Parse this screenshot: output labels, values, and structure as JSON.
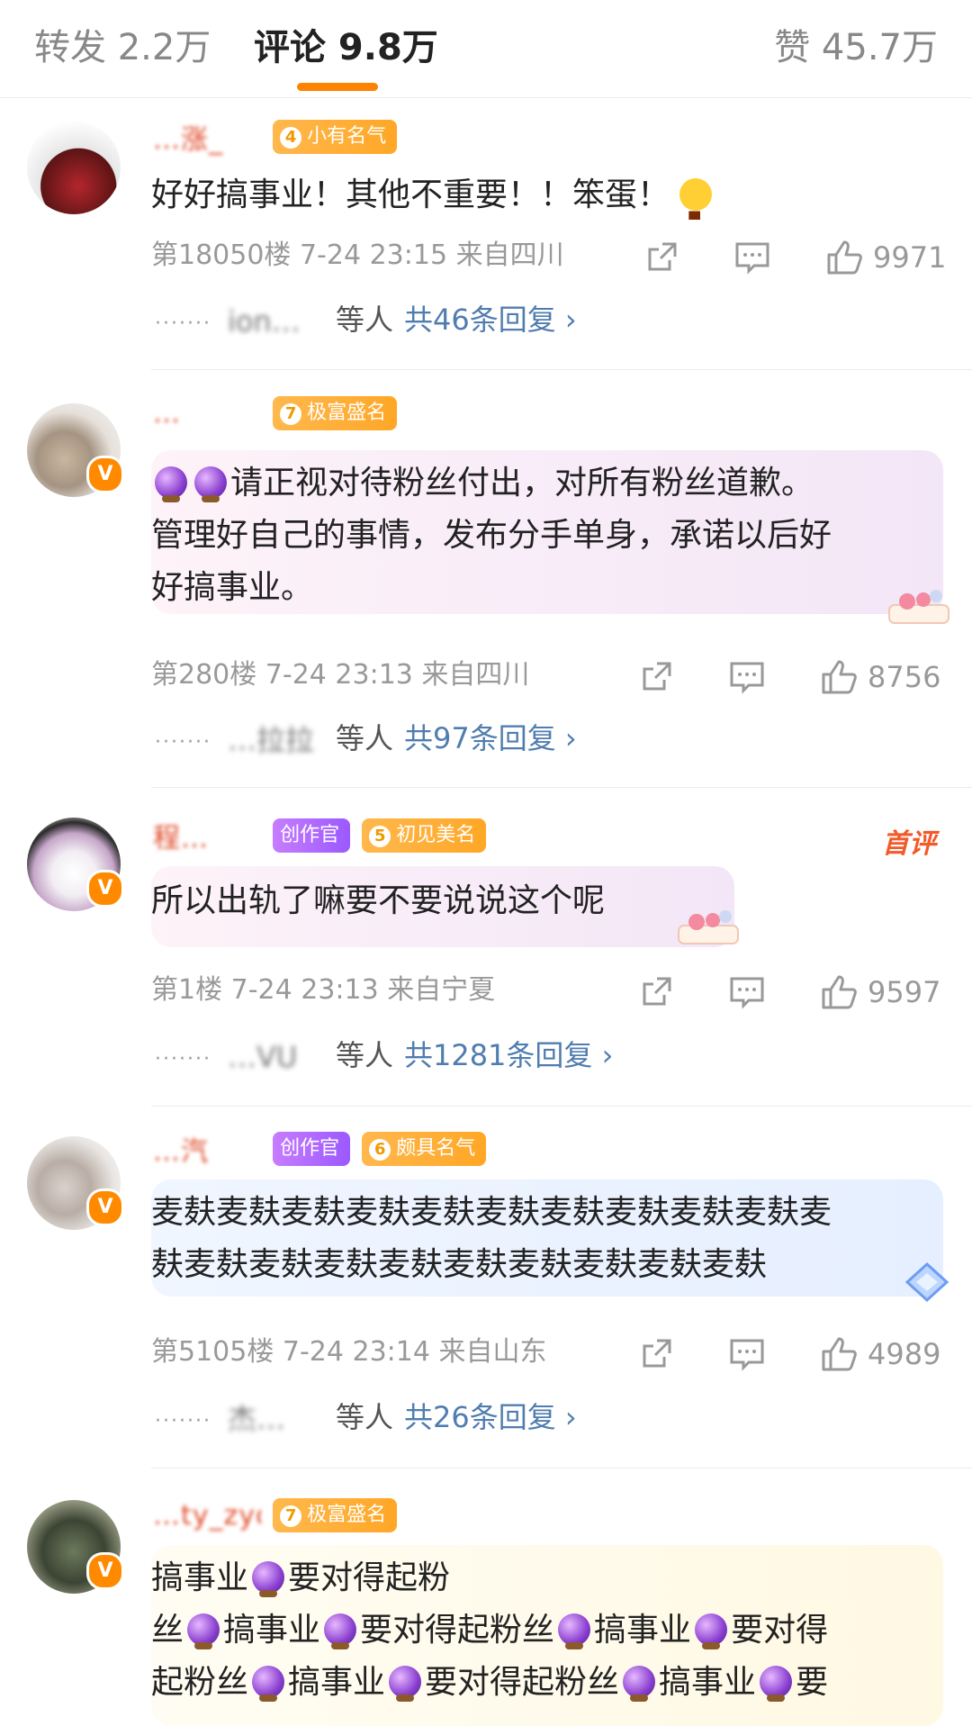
{
  "tabs": {
    "repost": "转发 2.2万",
    "comment": "评论 9.8万",
    "like": "赞 45.7万"
  },
  "comments": [
    {
      "username": "…涨_",
      "badges": [
        {
          "num": "4",
          "label": "小有名气"
        }
      ],
      "text": "好好搞事业！其他不重要！！笨蛋！",
      "meta": "第18050楼 7-24 23:15 来自四川",
      "likes": "9971",
      "reply_names": "ion…",
      "reply_suffix": "等人",
      "reply_total": "共46条回复 ›"
    },
    {
      "username": "…",
      "badges": [
        {
          "num": "7",
          "label": "极富盛名"
        }
      ],
      "text_line1": "请正视对待粉丝付出，对所有粉丝道歉。",
      "text_line2": "管理好自己的事情，发布分手单身，承诺以后好",
      "text_line3": "好搞事业。",
      "meta": "第280楼 7-24 23:13 来自四川",
      "likes": "8756",
      "reply_names": "…拉拉",
      "reply_suffix": "等人",
      "reply_total": "共97条回复 ›"
    },
    {
      "username": "程…",
      "badges": [
        {
          "label": "创作官"
        },
        {
          "num": "5",
          "label": "初见美名"
        }
      ],
      "first_review": "首评",
      "text": "所以出轨了嘛要不要说说这个呢",
      "meta": "第1楼 7-24 23:13 来自宁夏",
      "likes": "9597",
      "reply_names": "…VU",
      "reply_suffix": "等人",
      "reply_total": "共1281条回复 ›"
    },
    {
      "username": "…汽",
      "badges": [
        {
          "label": "创作官"
        },
        {
          "num": "6",
          "label": "颇具名气"
        }
      ],
      "text_line1": "麦麸麦麸麦麸麦麸麦麸麦麸麦麸麦麸麦麸麦麸麦",
      "text_line2": "麸麦麸麦麸麦麸麦麸麦麸麦麸麦麸麦麸麦麸",
      "meta": "第5105楼 7-24 23:14 来自山东",
      "likes": "4989",
      "reply_names": "杰…",
      "reply_suffix": "等人",
      "reply_total": "共26条回复 ›"
    },
    {
      "username": "…ty_zyo",
      "badges": [
        {
          "num": "7",
          "label": "极富盛名"
        }
      ],
      "line1": [
        "搞事业",
        "要对得起粉"
      ],
      "line2": [
        "丝",
        "搞事业",
        "要对得起粉丝",
        "搞事业",
        "要对得"
      ],
      "line3": [
        "起粉丝",
        "搞事业",
        "要对得起粉丝",
        "搞事业",
        "要"
      ]
    }
  ],
  "icons": {
    "share": "share-icon",
    "comment": "comment-icon",
    "like": "thumbs-up-icon",
    "verified": "verified-v-icon"
  },
  "colors": {
    "accent": "#ff8200",
    "link": "#507daf",
    "username": "#e04a28"
  }
}
